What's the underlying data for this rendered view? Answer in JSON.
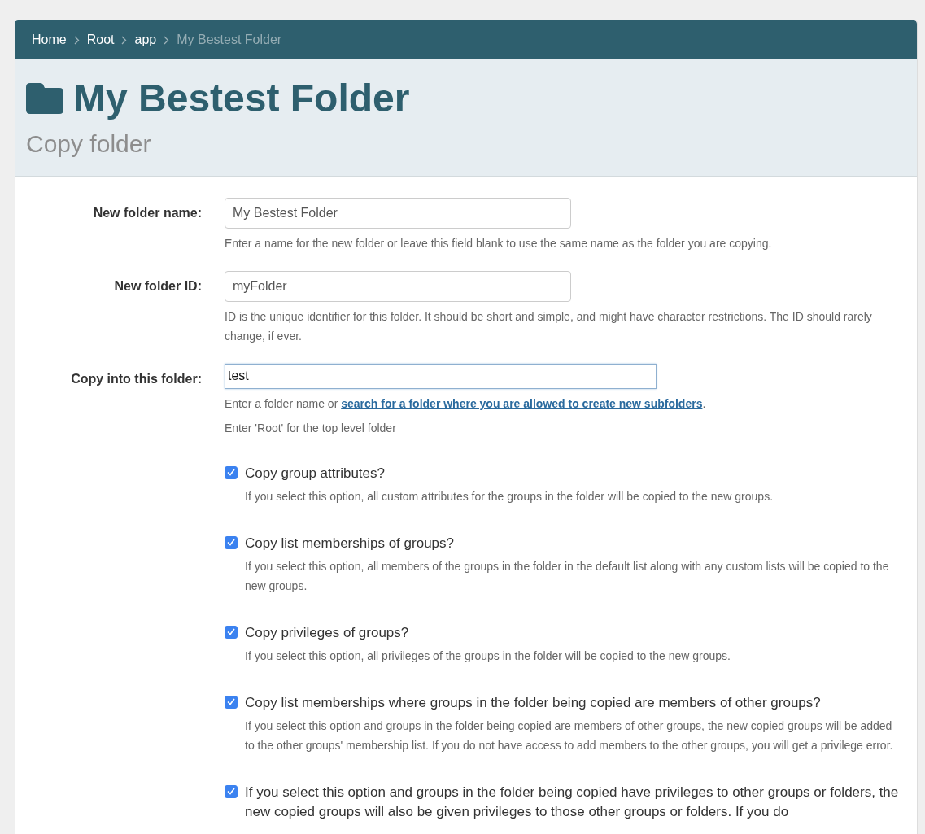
{
  "breadcrumb": [
    {
      "label": "Home",
      "current": false
    },
    {
      "label": "Root",
      "current": false
    },
    {
      "label": "app",
      "current": false
    },
    {
      "label": "My Bestest Folder",
      "current": true
    }
  ],
  "header": {
    "title": "My Bestest Folder",
    "subtitle": "Copy folder"
  },
  "fields": [
    {
      "kind": "text",
      "label": "New folder name:",
      "value": "My Bestest Folder",
      "focused": false,
      "help": [
        {
          "before": "Enter a name for the new folder or leave this field blank to use the same name as the folder you are copying."
        }
      ]
    },
    {
      "kind": "text",
      "label": "New folder ID:",
      "value": "myFolder",
      "focused": false,
      "help": [
        {
          "before": "ID is the unique identifier for this folder. It should be short and simple, and might have character restrictions. The ID should rarely change, if ever."
        }
      ]
    },
    {
      "kind": "folder",
      "label": "Copy into this folder:",
      "value": "test",
      "focused": true,
      "help": [
        {
          "before": "Enter a folder name or ",
          "link": "search for a folder where you are allowed to create new subfolders",
          "after": "."
        },
        {
          "before": "Enter 'Root' for the top level folder"
        }
      ]
    }
  ],
  "options": [
    {
      "label": "Copy group attributes?",
      "checked": true,
      "description": "If you select this option, all custom attributes for the groups in the folder will be copied to the new groups."
    },
    {
      "label": "Copy list memberships of groups?",
      "checked": true,
      "description": "If you select this option, all members of the groups in the folder in the default list along with any custom lists will be copied to the new groups."
    },
    {
      "label": "Copy privileges of groups?",
      "checked": true,
      "description": "If you select this option, all privileges of the groups in the folder will be copied to the new groups."
    },
    {
      "label": "Copy list memberships where groups in the folder being copied are members of other groups?",
      "checked": true,
      "description": "If you select this option and groups in the folder being copied are members of other groups, the new copied groups will be added to the other groups' membership list. If you do not have access to add members to the other groups, you will get a privilege error."
    },
    {
      "label": "If you select this option and groups in the folder being copied have privileges to other groups or folders, the new copied groups will also be given privileges to those other groups or folders. If you do",
      "checked": true
    }
  ]
}
